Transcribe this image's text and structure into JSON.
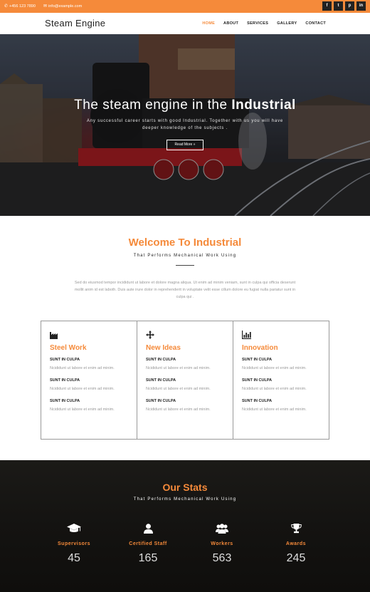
{
  "topbar": {
    "phone": "+456 123 7890",
    "email": "info@example.com",
    "socials": [
      "facebook",
      "twitter",
      "pinterest",
      "linkedin"
    ],
    "social_glyphs": [
      "f",
      "t",
      "p",
      "in"
    ]
  },
  "nav": {
    "brand": "Steam Engine",
    "items": [
      "HOME",
      "ABOUT",
      "SERVICES",
      "GALLERY",
      "CONTACT"
    ],
    "active": "HOME"
  },
  "hero": {
    "title_prefix": "The steam engine in the ",
    "title_bold": "Industrial",
    "subtitle": "Any successful career starts with good Industrial. Together with us you will have deeper knowledge of the subjects .",
    "button": "Read More »"
  },
  "welcome": {
    "title": "Welcome To Industrial",
    "subtitle": "That Performs Mechanical Work Using",
    "text": "Sed do eiusmod tempor incididunt ut labore et dolore magna aliqua. Ut enim ad minim veniam, sunt in culpa qui officia deserunt mollit anim id est laboth. Duis aute irure dolor in reprehenderit in voluptate velit esse cillum dolore eu fugiat nulla pariatur sunt in culpa qui ."
  },
  "features": [
    {
      "icon": "factory-icon",
      "title": "Steel Work",
      "items": [
        {
          "heading": "SUNT IN CULPA",
          "text": "Ncididunt ut labore et enim ad minim."
        },
        {
          "heading": "SUNT IN CULPA",
          "text": "Ncididunt ut labore et enim ad minim."
        },
        {
          "heading": "SUNT IN CULPA",
          "text": "Ncididunt ut labore et enim ad minim."
        }
      ]
    },
    {
      "icon": "move-arrows-icon",
      "title": "New Ideas",
      "items": [
        {
          "heading": "SUNT IN CULPA",
          "text": "Ncididunt ut labore et enim ad minim."
        },
        {
          "heading": "SUNT IN CULPA",
          "text": "Ncididunt ut labore et enim ad minim."
        },
        {
          "heading": "SUNT IN CULPA",
          "text": "Ncididunt ut labore et enim ad minim."
        }
      ]
    },
    {
      "icon": "bar-chart-icon",
      "title": "Innovation",
      "items": [
        {
          "heading": "SUNT IN CULPA",
          "text": "Ncididunt ut labore et enim ad minim."
        },
        {
          "heading": "SUNT IN CULPA",
          "text": "Ncididunt ut labore et enim ad minim."
        },
        {
          "heading": "SUNT IN CULPA",
          "text": "Ncididunt ut labore et enim ad minim."
        }
      ]
    }
  ],
  "stats": {
    "title": "Our Stats",
    "subtitle": "That Performs Mechanical Work Using",
    "items": [
      {
        "icon": "graduation-cap-icon",
        "label": "Supervisors",
        "value": "45"
      },
      {
        "icon": "user-icon",
        "label": "Certified Staff",
        "value": "165"
      },
      {
        "icon": "users-icon",
        "label": "Workers",
        "value": "563"
      },
      {
        "icon": "trophy-icon",
        "label": "Awards",
        "value": "245"
      }
    ]
  },
  "colors": {
    "accent": "#f58a3a",
    "dark": "#141311"
  }
}
